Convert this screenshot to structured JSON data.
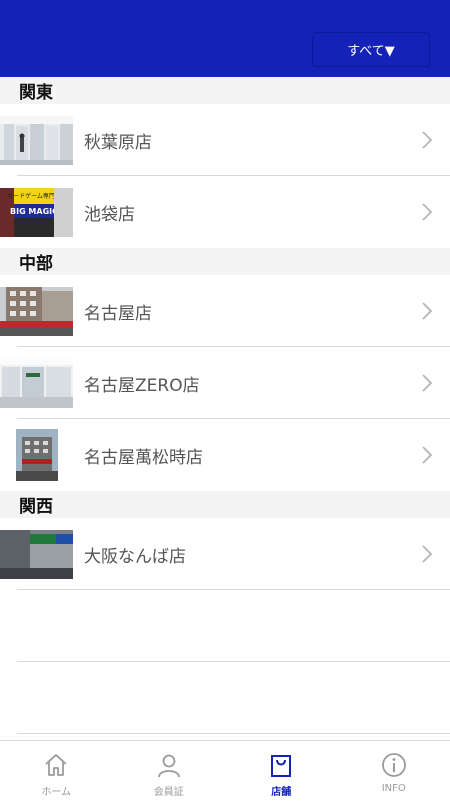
{
  "header": {
    "filter_label": "すべて▼"
  },
  "sections": [
    {
      "title": "関東",
      "stores": [
        {
          "name": "秋葉原店"
        },
        {
          "name": "池袋店"
        }
      ]
    },
    {
      "title": "中部",
      "stores": [
        {
          "name": "名古屋店"
        },
        {
          "name": "名古屋ZERO店"
        },
        {
          "name": "名古屋萬松時店"
        }
      ]
    },
    {
      "title": "関西",
      "stores": [
        {
          "name": "大阪なんば店"
        }
      ]
    }
  ],
  "tabs": [
    {
      "label": "ホーム",
      "icon": "home-icon"
    },
    {
      "label": "会員証",
      "icon": "person-icon"
    },
    {
      "label": "店舗",
      "icon": "bag-icon",
      "active": true
    },
    {
      "label": "INFO",
      "icon": "info-icon"
    }
  ],
  "colors": {
    "brand": "#1422b8",
    "active_tab": "#1422b8",
    "inactive_tab": "#9a9a9a"
  },
  "thumb_signage": {
    "ikebukuro_sign": "BIG MAGIC",
    "ikebukuro_sub": "カードゲーム専門店"
  }
}
